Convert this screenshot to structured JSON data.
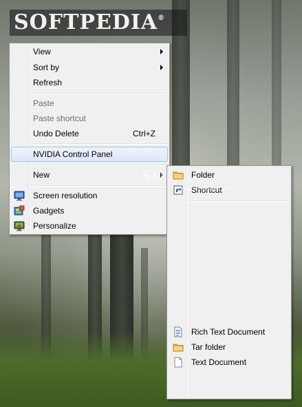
{
  "watermark": {
    "logo": "SOFTPEDIA",
    "logo_mark": "®",
    "overlay": "SOFTPEDIA",
    "overlay_url": "www.softpedia.com"
  },
  "context_menu": {
    "items": [
      {
        "label": "View",
        "submenu": true
      },
      {
        "label": "Sort by",
        "submenu": true
      },
      {
        "label": "Refresh"
      },
      {
        "label": "Paste",
        "disabled": true
      },
      {
        "label": "Paste shortcut",
        "disabled": true
      },
      {
        "label": "Undo Delete",
        "shortcut": "Ctrl+Z"
      },
      {
        "label": "NVIDIA Control Panel",
        "highlighted": true
      },
      {
        "label": "New",
        "submenu": true
      },
      {
        "label": "Screen resolution",
        "icon": "monitor-icon"
      },
      {
        "label": "Gadgets",
        "icon": "gadgets-icon"
      },
      {
        "label": "Personalize",
        "icon": "personalize-icon"
      }
    ]
  },
  "new_submenu": {
    "items": [
      {
        "label": "Folder",
        "icon": "folder-icon"
      },
      {
        "label": "Shortcut",
        "icon": "shortcut-icon"
      },
      {
        "label": "Rich Text Document",
        "icon": "rich-text-document-icon"
      },
      {
        "label": "Tar folder",
        "icon": "folder-icon"
      },
      {
        "label": "Text Document",
        "icon": "text-document-icon"
      }
    ]
  },
  "colors": {
    "menu_bg": "#f0f0f0",
    "highlight_border": "#a8c4e6",
    "disabled_text": "#6d6d6d"
  }
}
